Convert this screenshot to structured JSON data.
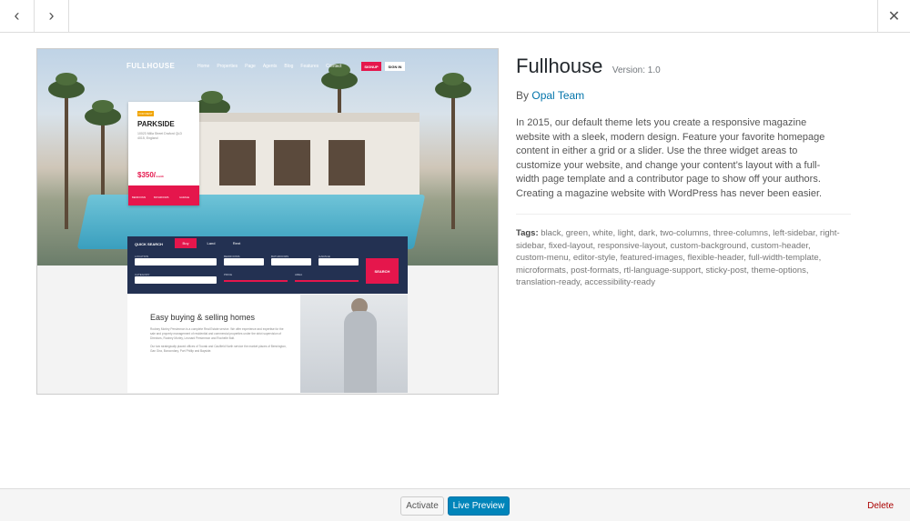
{
  "nav": {
    "prev_icon": "‹",
    "next_icon": "›",
    "close_icon": "✕"
  },
  "screenshot": {
    "logo": "FULLHOUSE",
    "nav_links": [
      "Home",
      "Properties",
      "Page",
      "Agents",
      "Blog",
      "Features",
      "Contact"
    ],
    "signup_label": "SIGNUP",
    "signin_label": "SIGN IN",
    "card": {
      "tag": "FOR RENT",
      "title": "PARKSIDE",
      "address": "10023 Milla Street Draford QLD 4015, England",
      "price": "$350/",
      "price_unit": "month",
      "features": [
        "BEDROOMS",
        "BATHROOMS",
        "GARAGE"
      ]
    },
    "search": {
      "heading": "QUICK SEARCH",
      "tabs": [
        "Buy",
        "Land",
        "Rent"
      ],
      "labels": [
        "LOCATION",
        "BEDROOMS",
        "BATHROOMS",
        "GARAGE",
        "CATEGORY",
        "PRICE",
        "AREA"
      ],
      "button": "SEARCH"
    },
    "about": {
      "heading": "Easy buying & selling homes",
      "para1": "Rodney Morley Persimmon is a complete Real Estate service. We offer experience and expertise for the sale and property management of residential and commercial properties under the strict supervision of Directors, Rodney Morley, Leonard Persimmon and Rochelle Bolt.",
      "para2": "Our two strategically placed offices of Toorak and Caulfield North service the market places of Bennington, Gan Gira, Boroondary, Port Phillip and Bayside."
    }
  },
  "theme": {
    "name": "Fullhouse",
    "version": "Version: 1.0",
    "by": "By",
    "author": "Opal Team",
    "description": "In 2015, our default theme lets you create a responsive magazine website with a sleek, modern design. Feature your favorite homepage content in either a grid or a slider. Use the three widget areas to customize your website, and change your content’s layout with a full-width page template and a contributor page to show off your authors. Creating a magazine website with WordPress has never been easier.",
    "tags_label": "Tags:",
    "tags": "black, green, white, light, dark, two-columns, three-columns, left-sidebar, right-sidebar, fixed-layout, responsive-layout, custom-background, custom-header, custom-menu, editor-style, featured-images, flexible-header, full-width-template, microformats, post-formats, rtl-language-support, sticky-post, theme-options, translation-ready, accessibility-ready"
  },
  "footer": {
    "activate_label": "Activate",
    "preview_label": "Live Preview",
    "delete_label": "Delete"
  },
  "colors": {
    "accent": "#e5164c",
    "link": "#0073aa",
    "primary_button": "#0085ba",
    "delete": "#aa0000",
    "search_panel": "#233152"
  }
}
